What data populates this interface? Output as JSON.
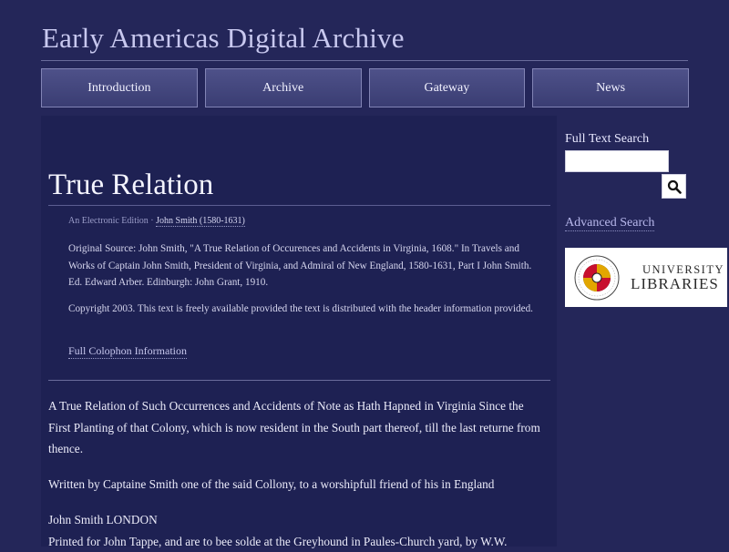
{
  "site": {
    "title": "Early Americas Digital Archive"
  },
  "nav": {
    "items": [
      {
        "label": "Introduction"
      },
      {
        "label": "Archive"
      },
      {
        "label": "Gateway"
      },
      {
        "label": "News"
      }
    ]
  },
  "main": {
    "title": "True Relation",
    "edition": {
      "label": "An Electronic Edition",
      "separator": "·",
      "author": "John Smith (1580-1631)"
    },
    "source": "Original Source: John Smith, \"A True Relation of Occurences and Accidents in Virginia, 1608.\" In Travels and Works of Captain John Smith, President of Virginia, and Admiral of New England, 1580-1631, Part I John Smith. Ed. Edward Arber. Edinburgh: John Grant, 1910.",
    "copyright": "Copyright 2003. This text is freely available provided the text is distributed with the header information provided.",
    "colophon_link": "Full Colophon Information",
    "body": {
      "paragraph1": "A True Relation of Such Occurrences and Accidents of Note as Hath Hapned in Virginia Since the First Planting of that Colony, which is now resident in the South part thereof, till the last returne from thence.",
      "paragraph2": "Written by Captaine Smith one of the said Collony, to a worshipfull friend of his in England",
      "line1": "John Smith LONDON",
      "line2": "Printed for John Tappe, and are to bee solde at the Greyhound in Paules-Church yard, by W.W."
    }
  },
  "sidebar": {
    "search_label": "Full Text Search",
    "search_value": "",
    "search_icon": "search-icon",
    "advanced_search": "Advanced Search",
    "logo": {
      "line1": "UNIVERSITY",
      "line2": "LIBRARIES",
      "seal_text": "UNIVERSITY OF MARYLAND"
    }
  },
  "colors": {
    "background": "#242659",
    "content_panel": "#1e2153",
    "nav_button": "#45487f"
  }
}
